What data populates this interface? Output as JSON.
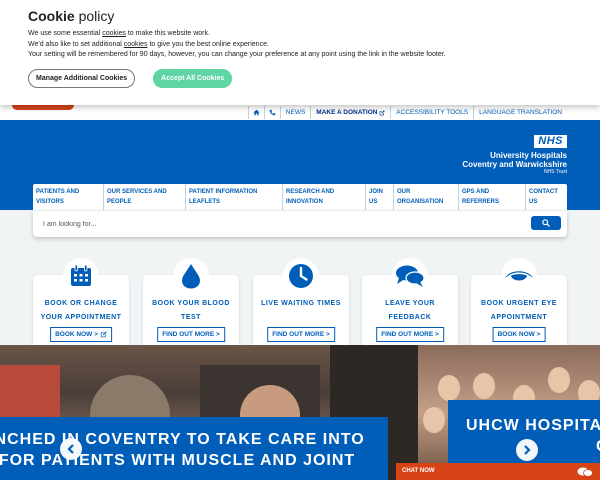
{
  "cookie": {
    "title_bold": "Cookie",
    "title_rest": " policy",
    "line1_pre": "We use some essential ",
    "line1_link": "cookies",
    "line1_post": " to make this website work.",
    "line2_pre": "We'd also like to set additional ",
    "line2_link": "cookies",
    "line2_post": " to give you the best online experience.",
    "line3": "Your setting will be remembered for 90 days, however, you can change your preference at any point using the link in the website footer.",
    "manage_label": "Manage Additional Cookies",
    "accept_label": "Accept All Cookies"
  },
  "toplinks": {
    "news": "NEWS",
    "donation": "MAKE A DONATION",
    "accessibility": "ACCESSIBILITY TOOLS",
    "language": "LANGUAGE TRANSLATION"
  },
  "logo": {
    "nhs": "NHS",
    "line1": "University Hospitals",
    "line2": "Coventry and Warwickshire",
    "line3": "NHS Trust"
  },
  "nav": [
    {
      "l1": "Patients and",
      "l2": "visitors"
    },
    {
      "l1": "Our services and",
      "l2": "people"
    },
    {
      "l1": "Patient information",
      "l2": "leaflets"
    },
    {
      "l1": "Research and",
      "l2": "innovation"
    },
    {
      "l1": "Join",
      "l2": "us"
    },
    {
      "l1": "Our",
      "l2": "organisation"
    },
    {
      "l1": "GPs and",
      "l2": "referrers"
    },
    {
      "l1": "Contact",
      "l2": "us"
    }
  ],
  "search": {
    "placeholder": "I am looking for..."
  },
  "cards": [
    {
      "l1": "Book or change",
      "l2": "your appointment",
      "button": "BOOK NOW >",
      "icon": "calendar-icon"
    },
    {
      "l1": "Book your blood",
      "l2": "test",
      "button": "FIND OUT MORE >",
      "icon": "blood-drop-icon"
    },
    {
      "l1": "Live waiting times",
      "l2": "",
      "button": "FIND OUT MORE >",
      "icon": "clock-icon"
    },
    {
      "l1": "Leave your",
      "l2": "feedback",
      "button": "FIND OUT MORE >",
      "icon": "speech-bubbles-icon"
    },
    {
      "l1": "Book urgent eye",
      "l2": "appointment",
      "button": "BOOK NOW >",
      "icon": "eye-icon"
    }
  ],
  "hero": {
    "left_l1": "UNCHED IN COVENTRY TO TAKE CARE INTO",
    "left_l2": "Y FOR PATIENTS WITH MUSCLE AND JOINT",
    "right_l1": "UHCW HOSPITAL",
    "right_l2": "C"
  },
  "chat": {
    "label": "CHAT NOW"
  },
  "colors": {
    "nhs_blue": "#005eb8",
    "accept_green": "#5fd4a4",
    "chat_orange": "#d84315"
  }
}
